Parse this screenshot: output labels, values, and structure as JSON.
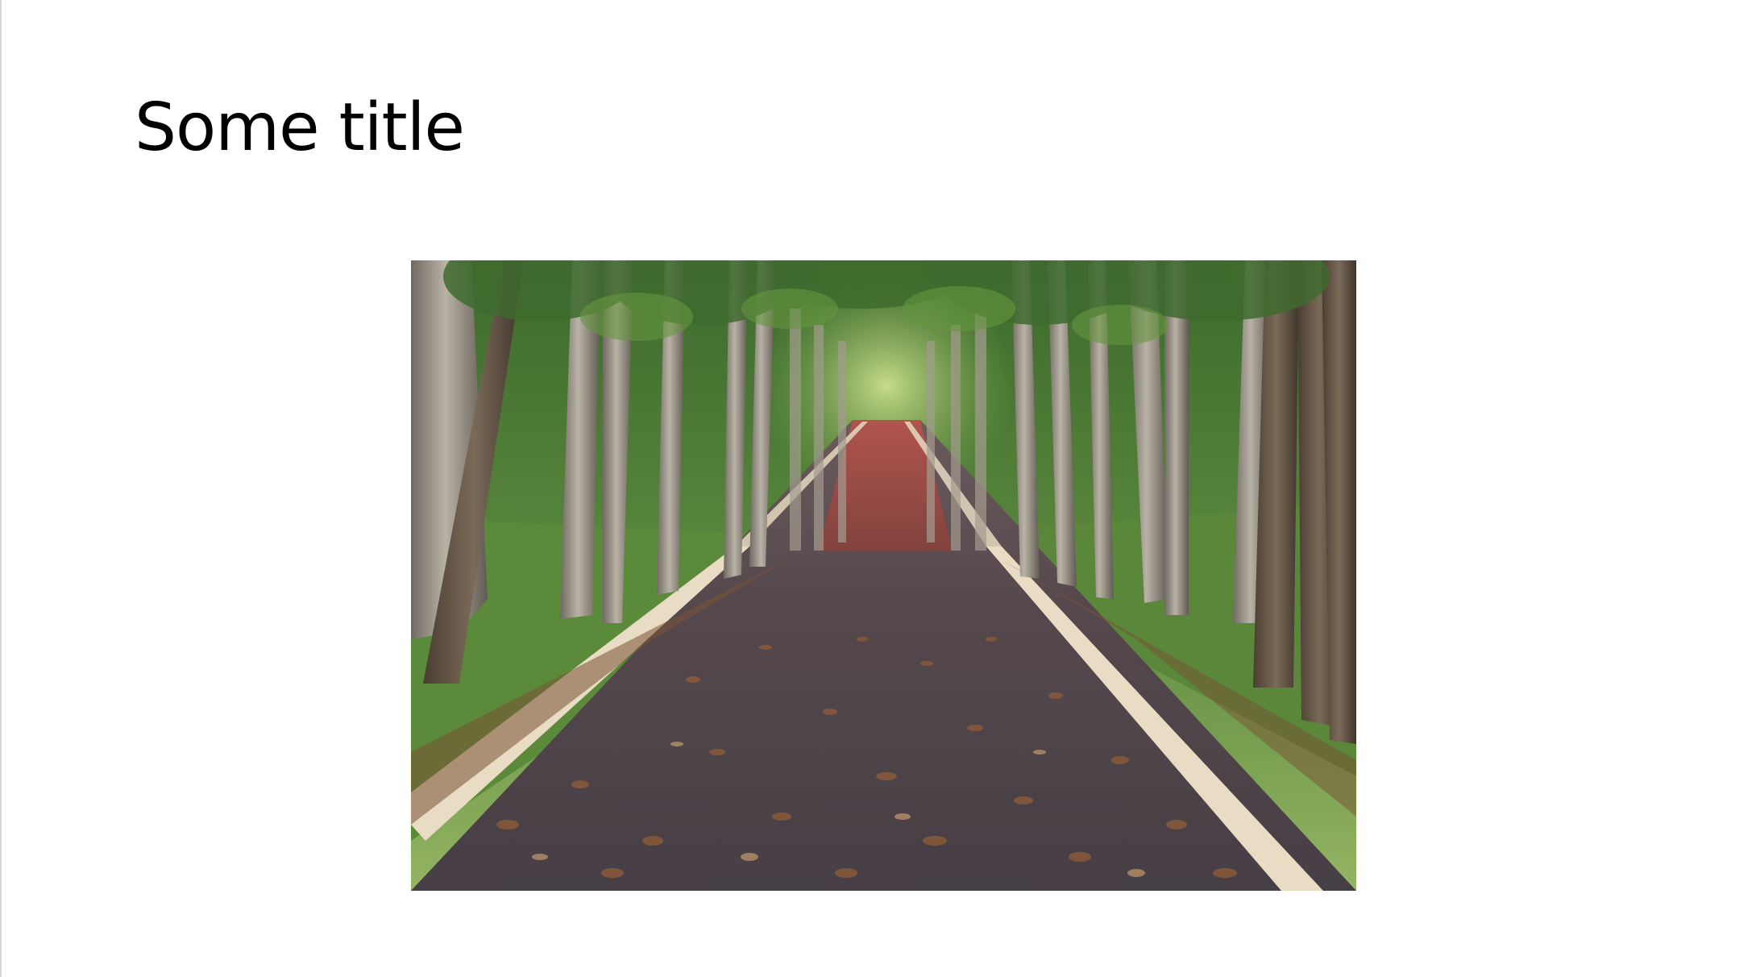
{
  "slide": {
    "title": "Some title"
  },
  "picture": {
    "subject": "road-through-forest-picture",
    "colors": {
      "asphalt": "#4a4449",
      "road_line": "#e8dcc4",
      "foliage": "#4f7a38",
      "grass": "#5f8f3e",
      "bark": "#8f877c",
      "leaves": "#8a5a3a",
      "far_road": "#b8443a"
    }
  }
}
